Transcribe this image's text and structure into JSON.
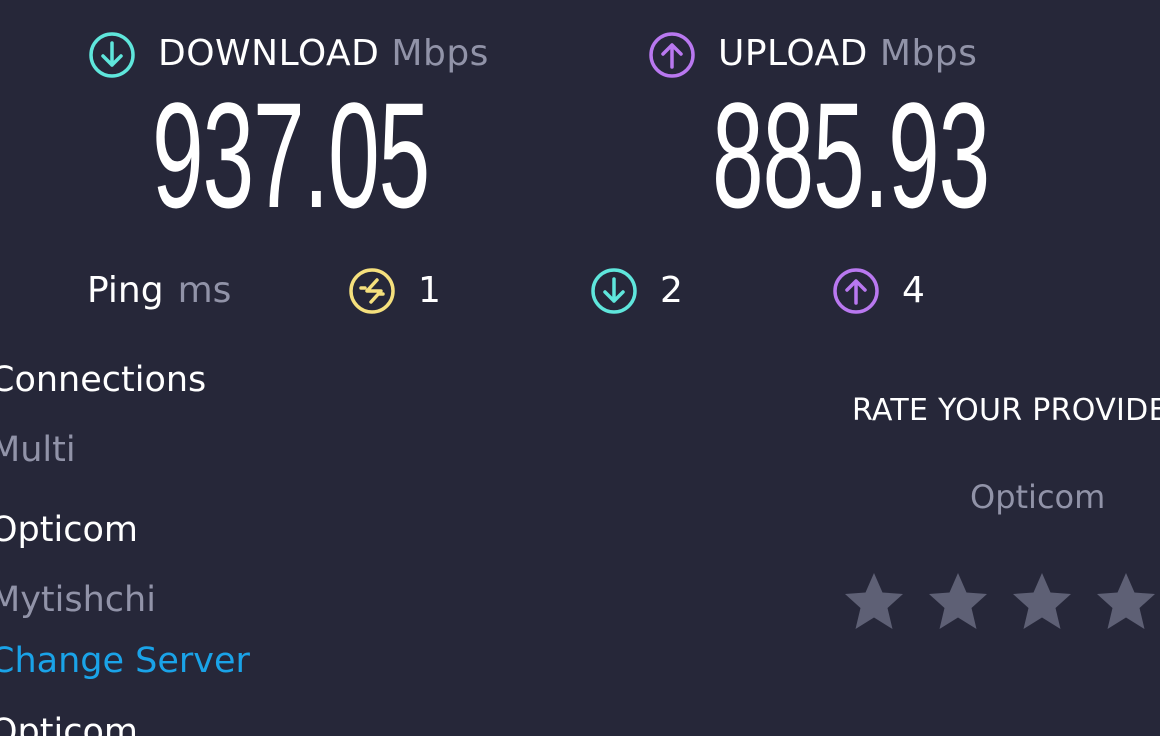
{
  "download": {
    "label": "DOWNLOAD",
    "unit": "Mbps",
    "value": "937.05",
    "icon": "download-arrow-icon",
    "color": "#5fe6dc"
  },
  "upload": {
    "label": "UPLOAD",
    "unit": "Mbps",
    "value": "885.93",
    "icon": "upload-arrow-icon",
    "color": "#b978f0"
  },
  "ping": {
    "label": "Ping",
    "unit": "ms",
    "idle": {
      "value": "1",
      "icon": "ping-exchange-icon",
      "color": "#f5e07d"
    },
    "download": {
      "value": "2",
      "icon": "download-arrow-icon",
      "color": "#5fe6dc"
    },
    "upload": {
      "value": "4",
      "icon": "upload-arrow-icon",
      "color": "#b978f0"
    }
  },
  "connections": {
    "label": "Connections",
    "value": "Multi"
  },
  "server": {
    "name": "Opticom",
    "location": "Mytishchi",
    "change_label": "Change Server"
  },
  "isp": {
    "name": "Opticom"
  },
  "rating": {
    "title": "RATE YOUR PROVIDER",
    "provider": "Opticom",
    "star_icon": "star-icon",
    "star_color": "#5e6075"
  }
}
